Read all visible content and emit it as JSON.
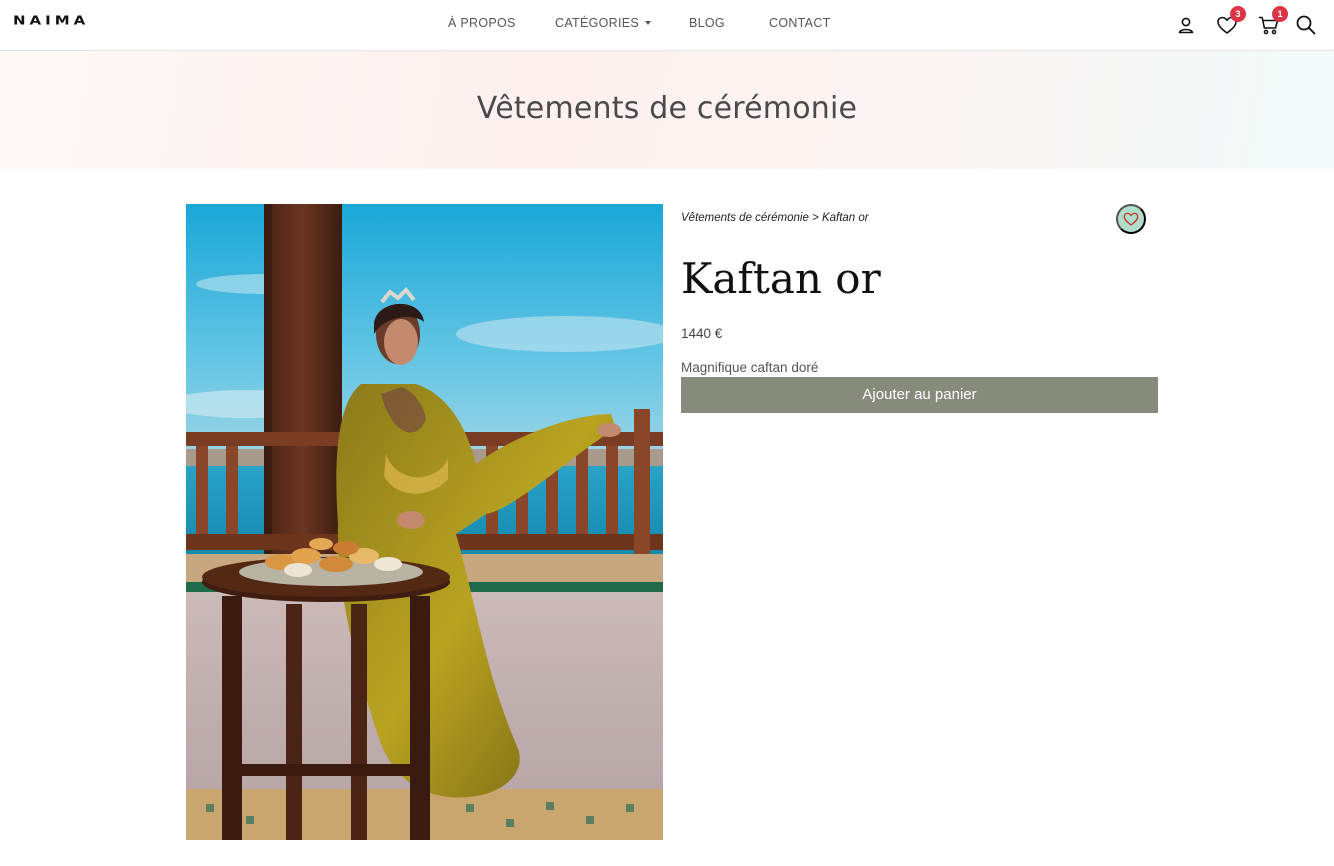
{
  "brand": {
    "logo_text": "NAIMA"
  },
  "nav": {
    "about": "À PROPOS",
    "categories": "CATÉGORIES",
    "blog": "BLOG",
    "contact": "CONTACT"
  },
  "header_icons": {
    "account": "user-icon",
    "wishlist": "heart-icon",
    "wishlist_count": "3",
    "cart": "cart-icon",
    "cart_count": "1",
    "search": "search-icon"
  },
  "hero": {
    "title": "Vêtements de cérémonie"
  },
  "product": {
    "breadcrumb": "Vêtements de cérémonie > Kaftan or",
    "name": "Kaftan or",
    "price": "1440 €",
    "description": "Magnifique caftan doré",
    "add_to_cart_label": "Ajouter au panier",
    "image_subject": "woman in golden kaftan seated on a seaside terrace beside a table of pastries"
  },
  "colors": {
    "badge": "#dc3545",
    "button": "#878b7c",
    "wish_button_bg": "#b2dccb",
    "wish_heart": "#c0392b"
  }
}
